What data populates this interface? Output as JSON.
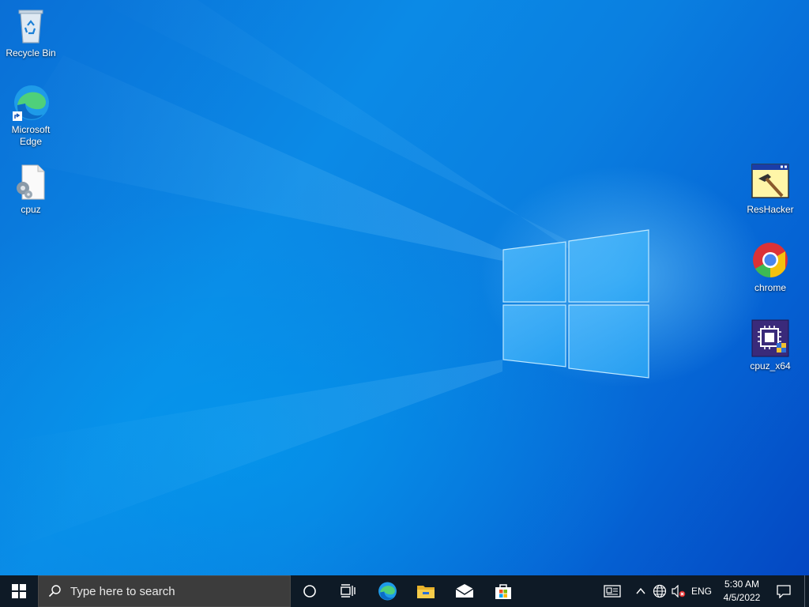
{
  "desktop": {
    "icons_left": [
      {
        "label": "Recycle Bin",
        "icon": "recycle-bin-icon"
      },
      {
        "label": "Microsoft Edge",
        "icon": "edge-icon"
      },
      {
        "label": "cpuz",
        "icon": "cpuz-file-icon"
      }
    ],
    "icons_right": [
      {
        "label": "ResHacker",
        "icon": "reshacker-icon"
      },
      {
        "label": "chrome",
        "icon": "chrome-icon"
      },
      {
        "label": "cpuz_x64",
        "icon": "cpuz-x64-icon"
      }
    ]
  },
  "taskbar": {
    "search_placeholder": "Type here to search",
    "pinned": [
      "cortana-icon",
      "task-view-icon",
      "edge-icon",
      "file-explorer-icon",
      "mail-icon",
      "store-icon"
    ],
    "tray": {
      "language": "ENG",
      "time": "5:30 AM",
      "date": "4/5/2022"
    }
  },
  "colors": {
    "wallpaper_primary": "#0a7fe0",
    "taskbar_bg": "#0e1a26",
    "search_bg": "#3c3c3c"
  }
}
